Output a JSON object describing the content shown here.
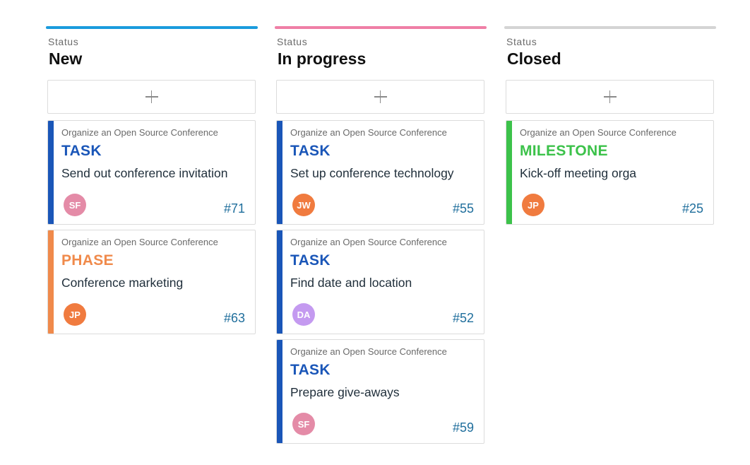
{
  "columns": [
    {
      "label": "Status",
      "title": "New",
      "color": "#1a9bdd",
      "add_symbol": "+",
      "cards": [
        {
          "project": "Organize an Open Source Conference",
          "type": "TASK",
          "type_color": "#1a56b8",
          "accent": "#1a56b8",
          "subject": "Send out conference invitation",
          "initials": "SF",
          "avatar_color": "#e48ba7",
          "number": "#71"
        },
        {
          "project": "Organize an Open Source Conference",
          "type": "PHASE",
          "type_color": "#f08a4b",
          "accent": "#f08a4b",
          "subject": "Conference marketing",
          "initials": "JP",
          "avatar_color": "#f07b3f",
          "number": "#63"
        }
      ]
    },
    {
      "label": "Status",
      "title": "In progress",
      "color": "#ef7fa6",
      "add_symbol": "+",
      "cards": [
        {
          "project": "Organize an Open Source Conference",
          "type": "TASK",
          "type_color": "#1a56b8",
          "accent": "#1a56b8",
          "subject": "Set up conference technology",
          "initials": "JW",
          "avatar_color": "#f07b3f",
          "number": "#55"
        },
        {
          "project": "Organize an Open Source Conference",
          "type": "TASK",
          "type_color": "#1a56b8",
          "accent": "#1a56b8",
          "subject": "Find date and location",
          "initials": "DA",
          "avatar_color": "#c49af0",
          "number": "#52"
        },
        {
          "project": "Organize an Open Source Conference",
          "type": "TASK",
          "type_color": "#1a56b8",
          "accent": "#1a56b8",
          "subject": "Prepare give-aways",
          "initials": "SF",
          "avatar_color": "#e48ba7",
          "number": "#59"
        }
      ]
    },
    {
      "label": "Status",
      "title": "Closed",
      "color": "#d4d4d4",
      "add_symbol": "+",
      "cards": [
        {
          "project": "Organize an Open Source Conference",
          "type": "MILESTONE",
          "type_color": "#3cc24a",
          "accent": "#3cc24a",
          "subject": "Kick-off meeting orga",
          "initials": "JP",
          "avatar_color": "#f07b3f",
          "number": "#25"
        }
      ]
    }
  ]
}
